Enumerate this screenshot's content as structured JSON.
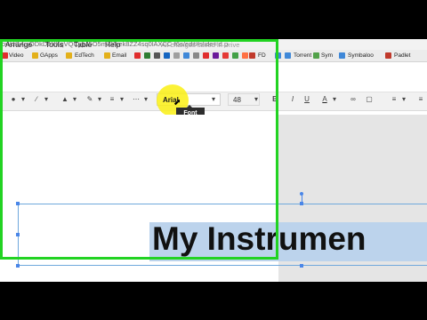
{
  "browser": {
    "url": "on/d/14ujODkDeXXqVQCypJ5O5mZYkek8ZZ4sq0lAXCC-f6s/edit#slide=id.p",
    "bookmarks": [
      {
        "label": "Video",
        "color": "#e02d2d"
      },
      {
        "label": "GApps",
        "color": "#3f88d8"
      },
      {
        "label": "EdTech",
        "color": "#3f88d8"
      },
      {
        "label": "Email",
        "color": "#e3a21a"
      },
      {
        "label": "FD",
        "color": "#c0392b"
      },
      {
        "label": "Torrent",
        "color": "#3f88d8"
      },
      {
        "label": "Sym",
        "color": "#52a24a"
      },
      {
        "label": "Symbaloo",
        "color": "#3f88d8"
      },
      {
        "label": "Padlet",
        "color": "#c0392b"
      }
    ]
  },
  "menu": {
    "items": [
      "Arrange",
      "Tools",
      "Table",
      "Help"
    ],
    "status": "All changes saved in Drive"
  },
  "toolbar": {
    "font": "Arial",
    "font_size": "48",
    "bold": "B",
    "underline": "U",
    "text_color": "A",
    "tooltip": "Font"
  },
  "slide": {
    "text": "My Instrumen"
  },
  "colors": {
    "recording_frame": "#22d322",
    "cursor_highlight": "#faf014",
    "selection_blue": "#bcd3ec"
  }
}
